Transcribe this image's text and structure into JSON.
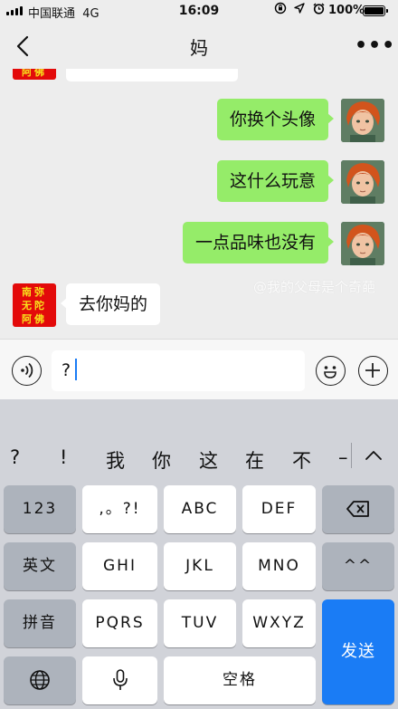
{
  "status_bar": {
    "carrier": "中国联通",
    "network": "4G",
    "time": "16:09",
    "battery_percent": "100%",
    "battery_level": 1.0,
    "icons": [
      "portrait-lock-icon",
      "location-icon",
      "alarm-icon"
    ]
  },
  "nav": {
    "title": "妈",
    "back_icon": "chevron-left-icon",
    "more_icon": "more-dots-icon"
  },
  "mom_avatar": {
    "lines": [
      "南弥",
      "无陀",
      "阿佛"
    ]
  },
  "messages": [
    {
      "sender": "me",
      "text": "你换个头像"
    },
    {
      "sender": "me",
      "text": "这什么玩意"
    },
    {
      "sender": "me",
      "text": "一点品味也没有"
    },
    {
      "sender": "mom",
      "text": "去你妈的"
    }
  ],
  "watermark": "@我的父母是个奇葩",
  "input": {
    "value": "?"
  },
  "colors": {
    "my_bubble": "#95ec69",
    "their_bubble": "#ffffff",
    "send_key": "#1a7cf5",
    "mom_avatar_bg": "#e30a0a",
    "mom_avatar_text": "#f8e21c"
  },
  "keyboard": {
    "candidates": [
      "?",
      "!",
      "我",
      "你",
      "这",
      "在",
      "不",
      "–"
    ],
    "rows": [
      [
        "123",
        ",。?!",
        "ABC",
        "DEF"
      ],
      [
        "英文",
        "GHI",
        "JKL",
        "MNO",
        "^^"
      ],
      [
        "拼音",
        "PQRS",
        "TUV",
        "WXYZ"
      ],
      [
        "空格"
      ]
    ],
    "send_label": "发送"
  }
}
